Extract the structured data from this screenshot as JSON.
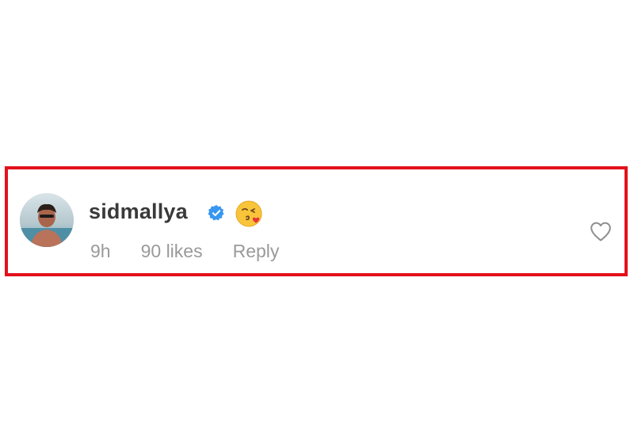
{
  "comment": {
    "username": "sidmallya",
    "verified": true,
    "emoji": "😘",
    "time": "9h",
    "likes": "90 likes",
    "reply_label": "Reply"
  },
  "icons": {
    "verified": "verified-badge-icon",
    "like": "heart-outline-icon",
    "emoji": "face-blowing-kiss-emoji"
  },
  "colors": {
    "highlight_border": "#e3111b",
    "username": "#3a3a3a",
    "meta_text": "#9a9a9a",
    "verified_blue": "#3897f0"
  }
}
